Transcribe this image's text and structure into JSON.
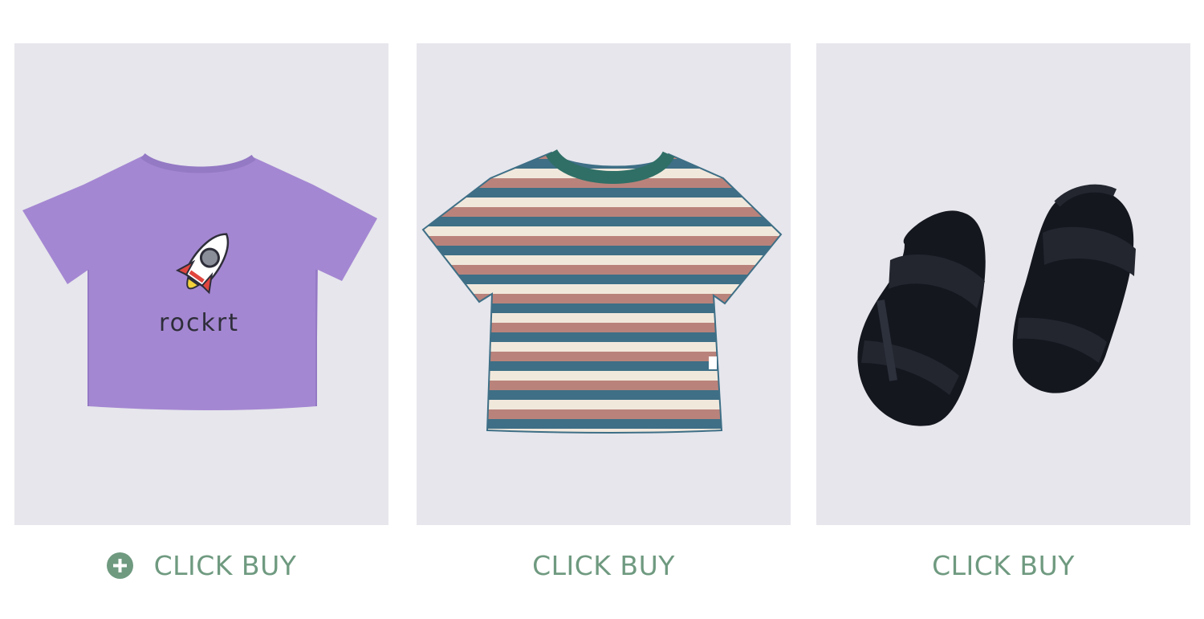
{
  "products": [
    {
      "name": "purple rocket t-shirt",
      "print_text": "rockrt",
      "buy_label": "CLICK BUY",
      "has_plus_icon": true,
      "colors": {
        "garment": "#a487d2",
        "print": "#2e2e3a"
      }
    },
    {
      "name": "striped t-shirt",
      "buy_label": "CLICK BUY",
      "has_plus_icon": false,
      "colors": {
        "stripe_a": "#3e6f86",
        "stripe_b": "#b9837b",
        "stripe_c": "#f1e8dc",
        "collar": "#2f6f66"
      }
    },
    {
      "name": "black sandals",
      "buy_label": "CLICK BUY",
      "has_plus_icon": false,
      "colors": {
        "sandal": "#15171f"
      }
    }
  ],
  "theme": {
    "card_background": "#e6e6ec",
    "accent": "#6f9a80",
    "page_background": "#ffffff"
  },
  "icons": {
    "buy_plus": "plus-circle-icon"
  }
}
